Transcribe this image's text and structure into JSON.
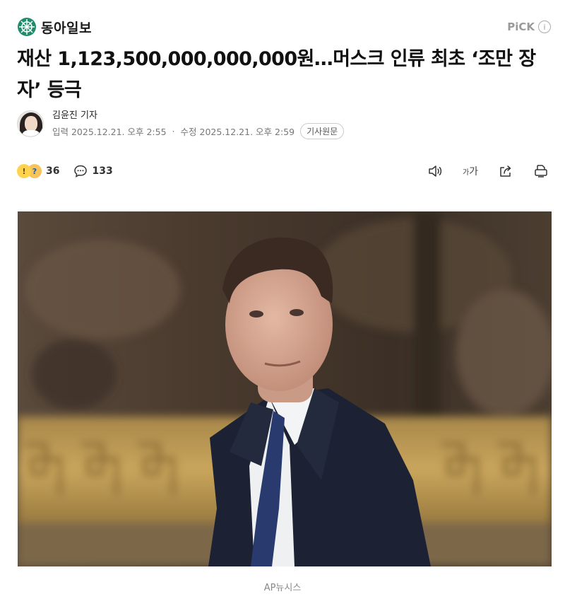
{
  "header": {
    "brand_name": "동아일보",
    "pick_label": "PiCK",
    "info_icon": "info-icon"
  },
  "article": {
    "headline": "재산 1,123,500,000,000,000원…머스크 인류 최초 ‘조만 장자’ 등극",
    "reporter": "김윤진 기자",
    "published": "입력 2025.12.21. 오후 2:55",
    "separator": "·",
    "modified": "수정 2025.12.21. 오후 2:59",
    "original_button": "기사원문"
  },
  "actions": {
    "reaction_count": "36",
    "comment_count": "133",
    "font_size_label_small": "가",
    "font_size_label_large": "가",
    "icons": [
      "reaction-emoji-icon",
      "comment-icon",
      "speaker-icon",
      "font-size-icon",
      "share-icon",
      "print-icon"
    ]
  },
  "photo": {
    "caption": "AP뉴시스",
    "description_icon": "news-photo"
  },
  "colors": {
    "text_primary": "#111111",
    "text_secondary": "#777777",
    "brand_logo": "#1f8c6b"
  }
}
